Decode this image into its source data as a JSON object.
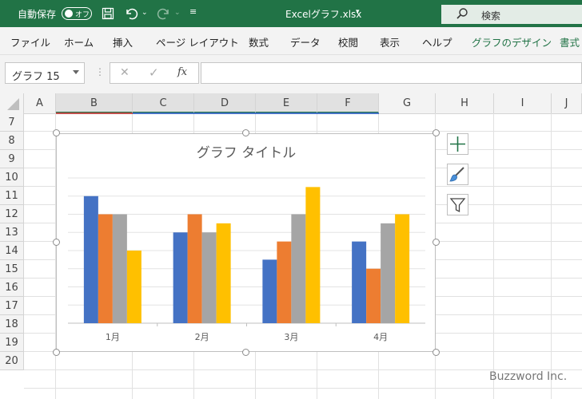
{
  "titlebar": {
    "autosave_label": "自動保存",
    "autosave_state": "オフ",
    "filename": "Excelグラフ.xlsx",
    "search_placeholder": "検索"
  },
  "ribbon": {
    "tabs": [
      "ファイル",
      "ホーム",
      "挿入",
      "ページ レイアウト",
      "数式",
      "データ",
      "校閲",
      "表示",
      "ヘルプ",
      "グラフのデザイン",
      "書式"
    ]
  },
  "formula_bar": {
    "name_box": "グラフ 15",
    "cancel": "✕",
    "enter": "✓",
    "fx": "fx"
  },
  "sheet": {
    "columns": [
      "A",
      "B",
      "C",
      "D",
      "E",
      "F",
      "G",
      "H",
      "I",
      "J"
    ],
    "rows": [
      "7",
      "8",
      "9",
      "10",
      "11",
      "12",
      "13",
      "14",
      "15",
      "16",
      "17",
      "18",
      "19",
      "20"
    ]
  },
  "chart_data": {
    "type": "bar",
    "title": "グラフ タイトル",
    "categories": [
      "1月",
      "2月",
      "3月",
      "4月"
    ],
    "series": [
      {
        "color": "#4472c4",
        "values": [
          14,
          10,
          7,
          9
        ]
      },
      {
        "color": "#ed7d31",
        "values": [
          12,
          12,
          9,
          6
        ]
      },
      {
        "color": "#a5a5a5",
        "values": [
          12,
          10,
          12,
          11
        ]
      },
      {
        "color": "#ffc000",
        "values": [
          8,
          11,
          15,
          12
        ]
      }
    ],
    "ylim": [
      0,
      16
    ],
    "grid": true,
    "legend": "none"
  },
  "watermark": "Buzzword Inc."
}
